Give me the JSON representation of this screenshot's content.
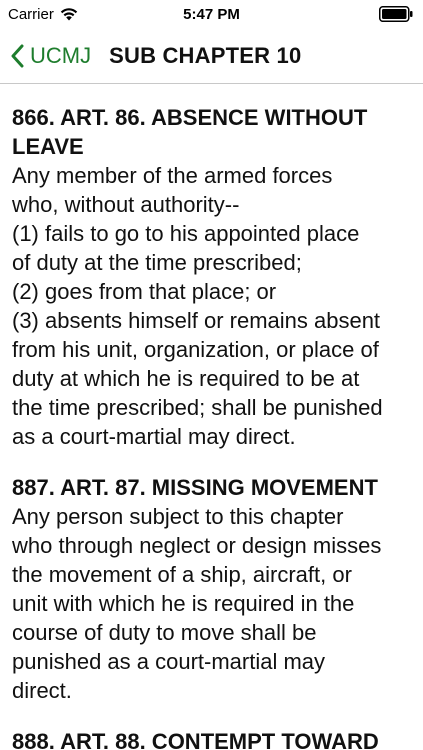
{
  "status_bar": {
    "carrier": "Carrier",
    "time": "5:47 PM",
    "wifi_icon": "wifi-icon",
    "battery_icon": "battery-icon"
  },
  "nav": {
    "back_label": "UCMJ",
    "title": "SUB CHAPTER 10",
    "accent_color": "#1e7d2d"
  },
  "articles": [
    {
      "heading": "866. ART. 86. ABSENCE WITHOUT LEAVE",
      "lines": [
        "Any member of the armed forces",
        "who, without authority--",
        "(1) fails to go to his appointed place",
        "of duty at the time prescribed;",
        "(2) goes from that place; or",
        "(3) absents himself or remains absent",
        "from his unit, organization, or place of",
        "duty at which he is required to be at",
        "the time prescribed; shall be punished",
        "as a court-martial may direct."
      ]
    },
    {
      "heading": "887. ART. 87. MISSING MOVEMENT",
      "lines": [
        "Any person subject to this chapter",
        "who through neglect or design misses",
        "the movement of a ship, aircraft, or",
        "unit with which he is required in the",
        "course of duty to move shall be",
        "punished as a court-martial may",
        "direct."
      ]
    },
    {
      "heading": "888. ART. 88. CONTEMPT TOWARD",
      "lines": []
    }
  ]
}
